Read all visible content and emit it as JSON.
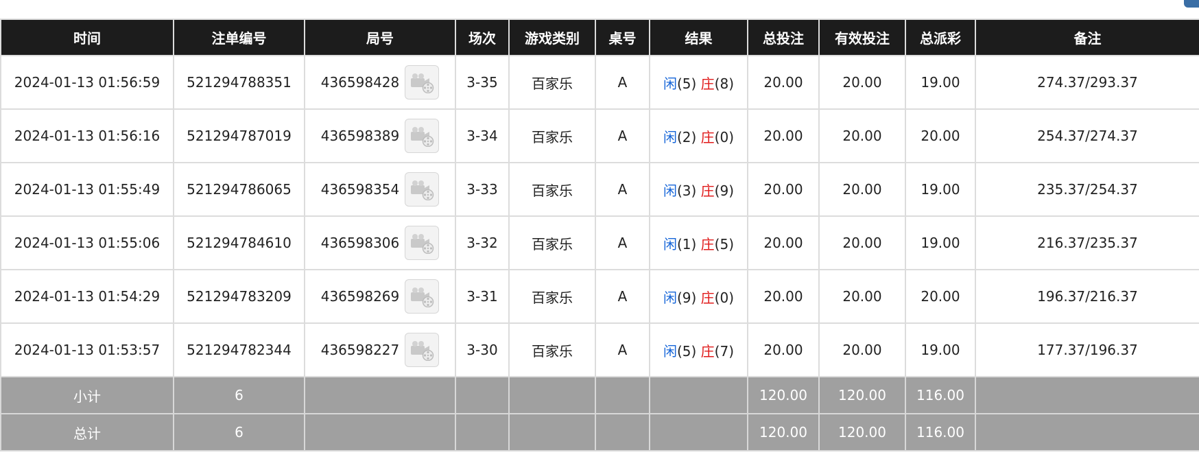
{
  "colors": {
    "header_bg": "#1c1c1c",
    "footer_bg": "#a0a0a0",
    "player_blue": "#1565d8",
    "banker_red": "#e01919",
    "grid_line": "#dcdcdc"
  },
  "columns": [
    "时间",
    "注单编号",
    "局号",
    "场次",
    "游戏类别",
    "桌号",
    "结果",
    "总投注",
    "有效投注",
    "总派彩",
    "备注"
  ],
  "labels": {
    "player": "闲",
    "banker": "庄",
    "video_icon": "video-camera-icon"
  },
  "rows": [
    {
      "time": "2024-01-13 01:56:59",
      "bet_id": "521294788351",
      "round": "436598428",
      "shoe": "3-35",
      "game": "百家乐",
      "table": "A",
      "player_score": "(5)",
      "banker_score": "(8)",
      "total_bet": "20.00",
      "valid_bet": "20.00",
      "payout": "19.00",
      "remark": "274.37/293.37"
    },
    {
      "time": "2024-01-13 01:56:16",
      "bet_id": "521294787019",
      "round": "436598389",
      "shoe": "3-34",
      "game": "百家乐",
      "table": "A",
      "player_score": "(2)",
      "banker_score": "(0)",
      "total_bet": "20.00",
      "valid_bet": "20.00",
      "payout": "20.00",
      "remark": "254.37/274.37"
    },
    {
      "time": "2024-01-13 01:55:49",
      "bet_id": "521294786065",
      "round": "436598354",
      "shoe": "3-33",
      "game": "百家乐",
      "table": "A",
      "player_score": "(3)",
      "banker_score": "(9)",
      "total_bet": "20.00",
      "valid_bet": "20.00",
      "payout": "19.00",
      "remark": "235.37/254.37"
    },
    {
      "time": "2024-01-13 01:55:06",
      "bet_id": "521294784610",
      "round": "436598306",
      "shoe": "3-32",
      "game": "百家乐",
      "table": "A",
      "player_score": "(1)",
      "banker_score": "(5)",
      "total_bet": "20.00",
      "valid_bet": "20.00",
      "payout": "19.00",
      "remark": "216.37/235.37"
    },
    {
      "time": "2024-01-13 01:54:29",
      "bet_id": "521294783209",
      "round": "436598269",
      "shoe": "3-31",
      "game": "百家乐",
      "table": "A",
      "player_score": "(9)",
      "banker_score": "(0)",
      "total_bet": "20.00",
      "valid_bet": "20.00",
      "payout": "20.00",
      "remark": "196.37/216.37"
    },
    {
      "time": "2024-01-13 01:53:57",
      "bet_id": "521294782344",
      "round": "436598227",
      "shoe": "3-30",
      "game": "百家乐",
      "table": "A",
      "player_score": "(5)",
      "banker_score": "(7)",
      "total_bet": "20.00",
      "valid_bet": "20.00",
      "payout": "19.00",
      "remark": "177.37/196.37"
    }
  ],
  "subtotal": {
    "label": "小计",
    "count": "6",
    "total_bet": "120.00",
    "valid_bet": "120.00",
    "payout": "116.00"
  },
  "grand_total": {
    "label": "总计",
    "count": "6",
    "total_bet": "120.00",
    "valid_bet": "120.00",
    "payout": "116.00"
  }
}
